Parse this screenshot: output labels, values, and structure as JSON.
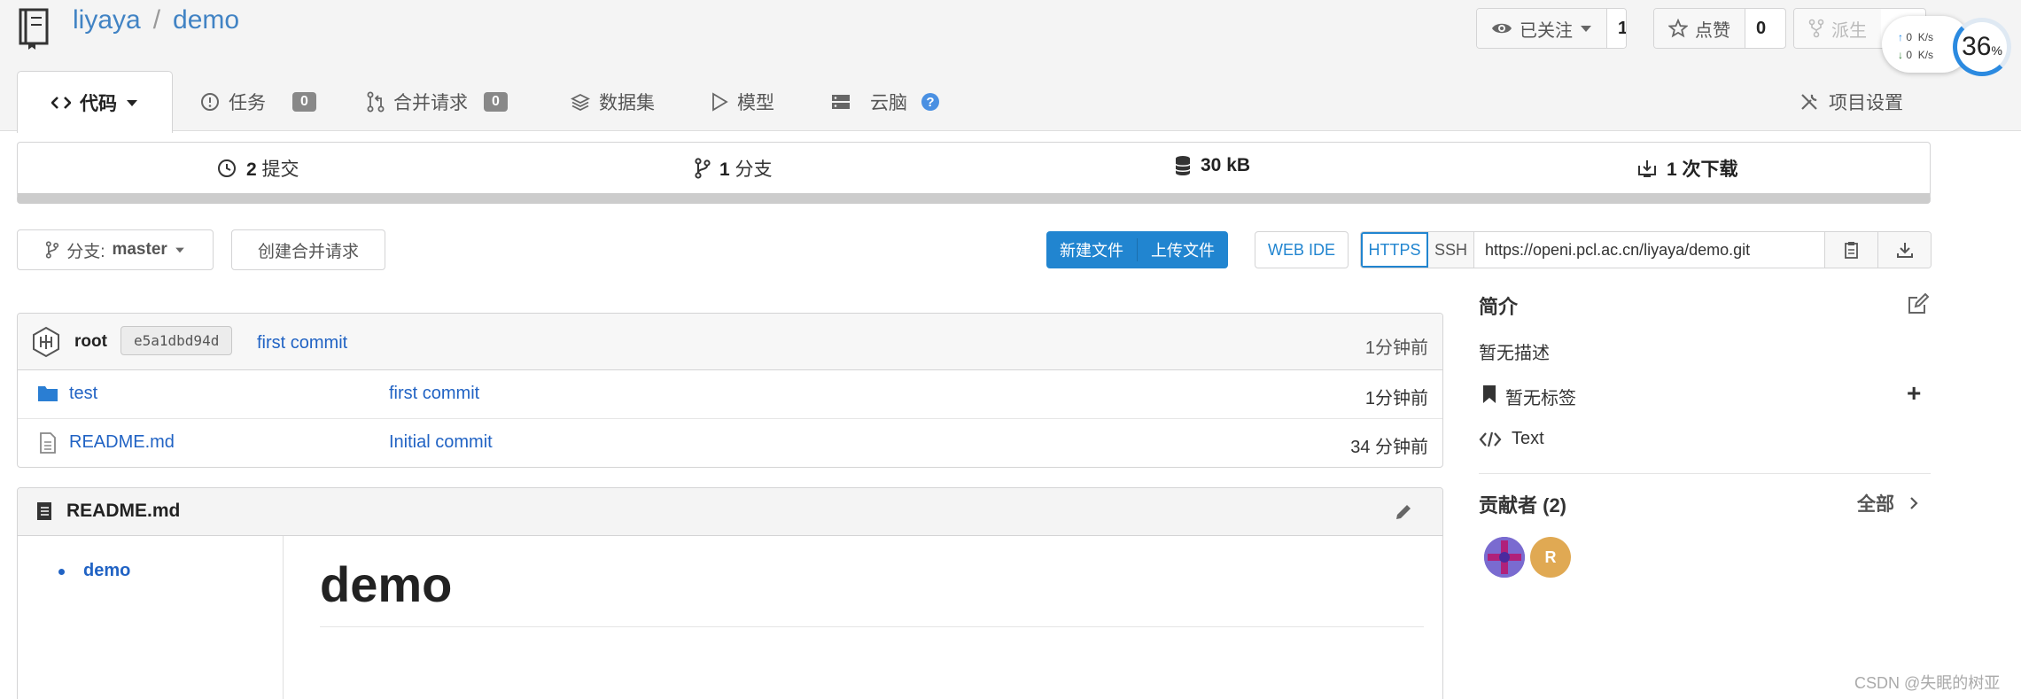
{
  "repo": {
    "owner": "liyaya",
    "separator": "/",
    "name": "demo"
  },
  "actions": {
    "watch_label": "已关注",
    "watch_count": "1",
    "star_label": "点赞",
    "star_count": "0",
    "fork_label": "派生"
  },
  "speed_widget": {
    "up": "0",
    "down": "0",
    "unit": "K/s",
    "percent": "36",
    "percent_sign": "%"
  },
  "tabs": {
    "code": "代码",
    "issues": "任务",
    "issues_count": "0",
    "pulls": "合并请求",
    "pulls_count": "0",
    "datasets": "数据集",
    "models": "模型",
    "cloudbrain": "云脑",
    "help": "?",
    "settings": "项目设置"
  },
  "stats": {
    "commits_num": "2",
    "commits_label": "提交",
    "branches_num": "1",
    "branches_label": "分支",
    "size": "30 kB",
    "downloads_num": "1",
    "downloads_label": "次下载"
  },
  "branch": {
    "prefix": "分支:",
    "name": "master"
  },
  "create_pr": "创建合并请求",
  "new_file": "新建文件",
  "upload_file": "上传文件",
  "web_ide": "WEB IDE",
  "clone": {
    "https": "HTTPS",
    "ssh": "SSH",
    "url": "https://openi.pcl.ac.cn/liyaya/demo.git"
  },
  "latest_commit": {
    "author": "root",
    "sha": "e5a1dbd94d",
    "message": "first commit",
    "time": "1分钟前"
  },
  "files": [
    {
      "name": "test",
      "type": "folder",
      "message": "first commit",
      "time": "1分钟前"
    },
    {
      "name": "README.md",
      "type": "file",
      "message": "Initial commit",
      "time": "34 分钟前"
    }
  ],
  "readme": {
    "filename": "README.md",
    "toc_item": "demo",
    "heading": "demo"
  },
  "sidebar": {
    "intro_title": "简介",
    "no_description": "暂无描述",
    "no_tags": "暂无标签",
    "add_tag": "+",
    "language": "Text",
    "contributors_title": "贡献者 (2)",
    "view_all": "全部",
    "contributor_initial": "R"
  },
  "watermark": "CSDN @失眠的树亚",
  "colors": {
    "primary": "#2185d0",
    "link": "#2163c4",
    "badge": "#888888"
  }
}
